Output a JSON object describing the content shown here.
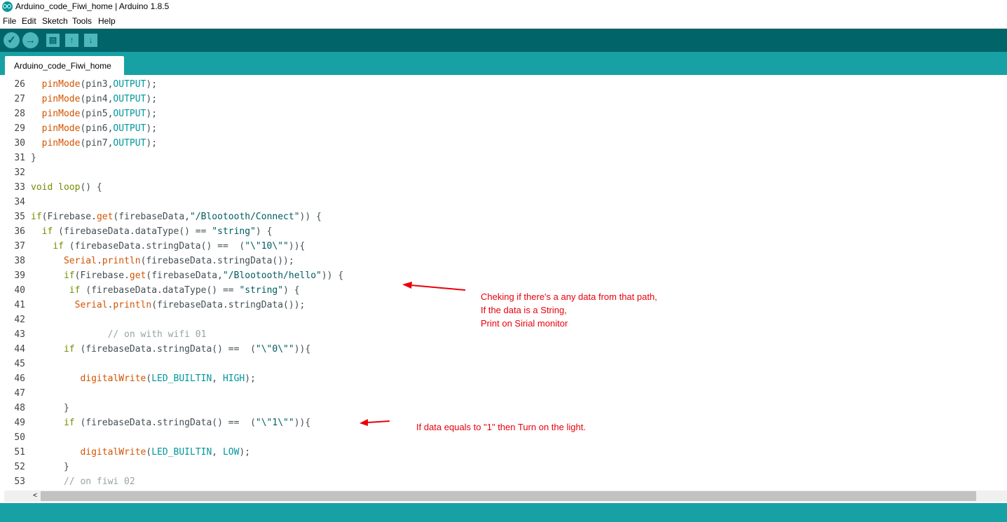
{
  "window": {
    "title": "Arduino_code_Fiwi_home | Arduino 1.8.5"
  },
  "menu": [
    "File",
    "Edit",
    "Sketch",
    "Tools",
    "Help"
  ],
  "toolbar": {
    "buttons": [
      {
        "name": "verify",
        "glyph": "✓"
      },
      {
        "name": "upload",
        "glyph": "→"
      },
      {
        "name": "new",
        "glyph": "▤"
      },
      {
        "name": "open",
        "glyph": "↑"
      },
      {
        "name": "save",
        "glyph": "↓"
      }
    ]
  },
  "tabs": [
    {
      "label": "Arduino_code_Fiwi_home"
    }
  ],
  "colors": {
    "toolbar": "#006468",
    "tabbar": "#17a1a5",
    "keyword": "#728e00",
    "function": "#d35400",
    "constant": "#00979c",
    "string": "#005c5f",
    "annotation": "#e8000b"
  },
  "code": [
    {
      "n": "26",
      "t": [
        [
          "  ",
          ""
        ],
        [
          "pinMode",
          "fn"
        ],
        [
          "(pin3,",
          ""
        ],
        [
          "OUTPUT",
          "const"
        ],
        [
          ");",
          ""
        ]
      ]
    },
    {
      "n": "27",
      "t": [
        [
          "  ",
          ""
        ],
        [
          "pinMode",
          "fn"
        ],
        [
          "(pin4,",
          ""
        ],
        [
          "OUTPUT",
          "const"
        ],
        [
          ");",
          ""
        ]
      ]
    },
    {
      "n": "28",
      "t": [
        [
          "  ",
          ""
        ],
        [
          "pinMode",
          "fn"
        ],
        [
          "(pin5,",
          ""
        ],
        [
          "OUTPUT",
          "const"
        ],
        [
          ");",
          ""
        ]
      ]
    },
    {
      "n": "29",
      "t": [
        [
          "  ",
          ""
        ],
        [
          "pinMode",
          "fn"
        ],
        [
          "(pin6,",
          ""
        ],
        [
          "OUTPUT",
          "const"
        ],
        [
          ");",
          ""
        ]
      ]
    },
    {
      "n": "30",
      "t": [
        [
          "  ",
          ""
        ],
        [
          "pinMode",
          "fn"
        ],
        [
          "(pin7,",
          ""
        ],
        [
          "OUTPUT",
          "const"
        ],
        [
          ");",
          ""
        ]
      ]
    },
    {
      "n": "31",
      "t": [
        [
          "}",
          ""
        ]
      ]
    },
    {
      "n": "32",
      "t": []
    },
    {
      "n": "33",
      "t": [
        [
          "void",
          "kw"
        ],
        [
          " ",
          ""
        ],
        [
          "loop",
          "kw"
        ],
        [
          "() {",
          ""
        ]
      ]
    },
    {
      "n": "34",
      "t": []
    },
    {
      "n": "35",
      "t": [
        [
          "if",
          "kw"
        ],
        [
          "(Firebase.",
          ""
        ],
        [
          "get",
          "fn"
        ],
        [
          "(firebaseData,",
          ""
        ],
        [
          "\"/Blootooth/Connect\"",
          "str"
        ],
        [
          ")) {",
          ""
        ]
      ]
    },
    {
      "n": "36",
      "t": [
        [
          "  ",
          ""
        ],
        [
          "if",
          "kw"
        ],
        [
          " (firebaseData.dataType() == ",
          ""
        ],
        [
          "\"string\"",
          "str"
        ],
        [
          ") {",
          ""
        ]
      ]
    },
    {
      "n": "37",
      "t": [
        [
          "    ",
          ""
        ],
        [
          "if",
          "kw"
        ],
        [
          " (firebaseData.stringData() ==  (",
          ""
        ],
        [
          "\"\\\"10\\\"\"",
          "str"
        ],
        [
          ")){",
          ""
        ]
      ]
    },
    {
      "n": "38",
      "t": [
        [
          "      ",
          ""
        ],
        [
          "Serial",
          "fn"
        ],
        [
          ".",
          ""
        ],
        [
          "println",
          "fn"
        ],
        [
          "(firebaseData.stringData());",
          ""
        ]
      ]
    },
    {
      "n": "39",
      "t": [
        [
          "      ",
          ""
        ],
        [
          "if",
          "kw"
        ],
        [
          "(Firebase.",
          ""
        ],
        [
          "get",
          "fn"
        ],
        [
          "(firebaseData,",
          ""
        ],
        [
          "\"/Blootooth/hello\"",
          "str"
        ],
        [
          ")) {",
          ""
        ]
      ]
    },
    {
      "n": "40",
      "t": [
        [
          "       ",
          ""
        ],
        [
          "if",
          "kw"
        ],
        [
          " (firebaseData.dataType() == ",
          ""
        ],
        [
          "\"string\"",
          "str"
        ],
        [
          ") {",
          ""
        ]
      ]
    },
    {
      "n": "41",
      "t": [
        [
          "        ",
          ""
        ],
        [
          "Serial",
          "fn"
        ],
        [
          ".",
          ""
        ],
        [
          "println",
          "fn"
        ],
        [
          "(firebaseData.stringData());",
          ""
        ]
      ]
    },
    {
      "n": "42",
      "t": []
    },
    {
      "n": "43",
      "t": [
        [
          "              ",
          ""
        ],
        [
          "// on with wifi 01",
          "cm"
        ]
      ]
    },
    {
      "n": "44",
      "t": [
        [
          "      ",
          ""
        ],
        [
          "if",
          "kw"
        ],
        [
          " (firebaseData.stringData() ==  (",
          ""
        ],
        [
          "\"\\\"0\\\"\"",
          "str"
        ],
        [
          ")){",
          ""
        ]
      ]
    },
    {
      "n": "45",
      "t": []
    },
    {
      "n": "46",
      "t": [
        [
          "         ",
          ""
        ],
        [
          "digitalWrite",
          "fn"
        ],
        [
          "(",
          ""
        ],
        [
          "LED_BUILTIN",
          "const"
        ],
        [
          ", ",
          ""
        ],
        [
          "HIGH",
          "const"
        ],
        [
          ");",
          ""
        ]
      ]
    },
    {
      "n": "47",
      "t": []
    },
    {
      "n": "48",
      "t": [
        [
          "      }",
          ""
        ]
      ]
    },
    {
      "n": "49",
      "t": [
        [
          "      ",
          ""
        ],
        [
          "if",
          "kw"
        ],
        [
          " (firebaseData.stringData() ==  (",
          ""
        ],
        [
          "\"\\\"1\\\"\"",
          "str"
        ],
        [
          ")){",
          ""
        ]
      ]
    },
    {
      "n": "50",
      "t": []
    },
    {
      "n": "51",
      "t": [
        [
          "         ",
          ""
        ],
        [
          "digitalWrite",
          "fn"
        ],
        [
          "(",
          ""
        ],
        [
          "LED_BUILTIN",
          "const"
        ],
        [
          ", ",
          ""
        ],
        [
          "LOW",
          "const"
        ],
        [
          ");",
          ""
        ]
      ]
    },
    {
      "n": "52",
      "t": [
        [
          "      }",
          ""
        ]
      ]
    },
    {
      "n": "53",
      "t": [
        [
          "      ",
          ""
        ],
        [
          "// on fiwi 02",
          "cm"
        ]
      ]
    }
  ],
  "annotations": {
    "note1": [
      "Cheking if there's a any data from that path,",
      "If the data is a String,",
      "Print on Sirial monitor"
    ],
    "note2": "If data equals to \"1\" then Turn on the light."
  },
  "scrollbar": {
    "left_arrow": "<"
  }
}
